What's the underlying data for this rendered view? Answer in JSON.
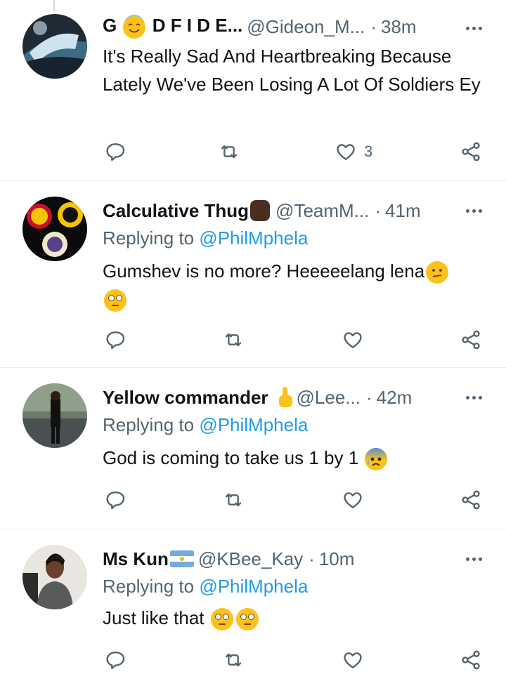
{
  "tweets": [
    {
      "name_prefix": "G",
      "name_suffix": "D F I D E...",
      "name_emoji": "halo-smile",
      "handle": "@Gideon_M...",
      "time": "38m",
      "replying_label": "",
      "replying_to": "",
      "text": "It's Really Sad And Heartbreaking Because Lately We've Been Losing A Lot Of Soldiers Ey",
      "like_count": "3"
    },
    {
      "name": "Calculative Thug",
      "name_emoji": "raised-fist-dark",
      "handle": "@TeamM...",
      "time": "41m",
      "replying_label": "Replying to",
      "replying_to": "@PhilMphela",
      "text": "Gumshev is no more? Heeeeelang lena",
      "like_count": ""
    },
    {
      "name": "Yellow commander",
      "name_emoji": "pointing-up-hand",
      "handle": "@Lee...",
      "time": "42m",
      "replying_label": "Replying to",
      "replying_to": "@PhilMphela",
      "text": "God is coming to take us 1 by 1",
      "like_count": ""
    },
    {
      "name": "Ms Kun",
      "name_emoji": "argentina-flag",
      "handle": "@KBee_Kay",
      "time": "10m",
      "replying_label": "Replying to",
      "replying_to": "@PhilMphela",
      "text": "Just like that",
      "like_count": ""
    }
  ],
  "icons": {
    "reply": "reply-icon",
    "retweet": "retweet-icon",
    "like": "heart-icon",
    "share": "share-icon",
    "more": "more-icon"
  },
  "colors": {
    "link": "#1d9bf0",
    "secondary_text": "#536471",
    "primary_text": "#0f1419",
    "divider": "#e6ecf0"
  }
}
